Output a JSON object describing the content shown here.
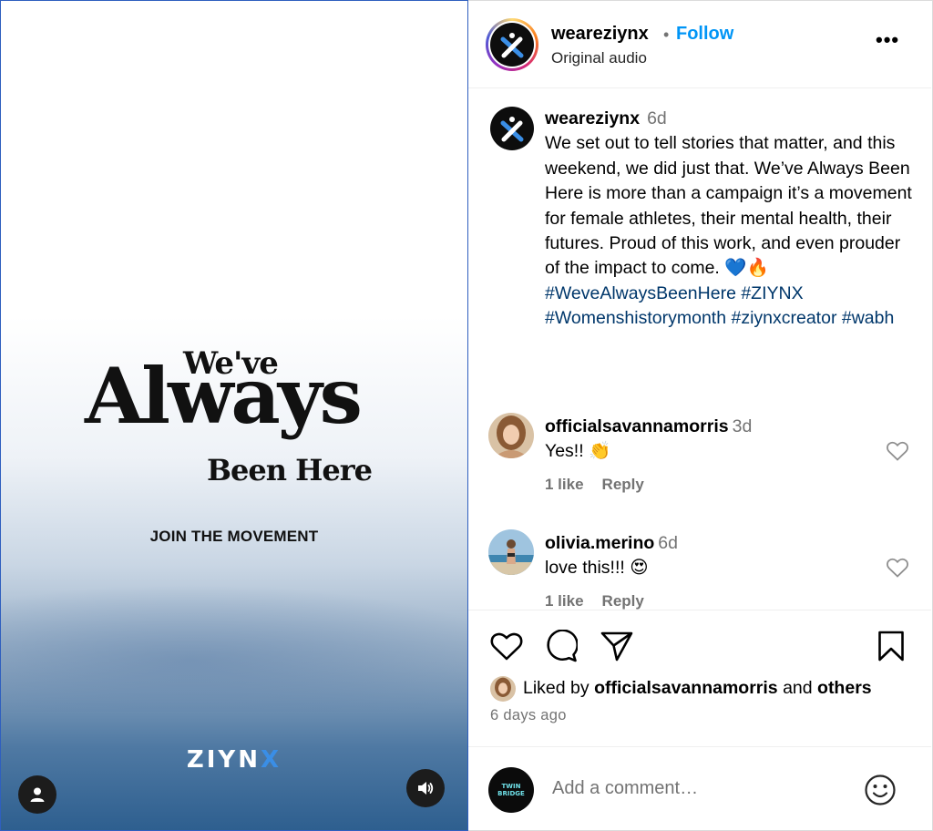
{
  "media": {
    "title_small": "We've",
    "title_big": "Always",
    "title_end": "Been Here",
    "cta": "JOIN THE MOVEMENT",
    "brand_main": "ZIYN",
    "brand_x": "X"
  },
  "header": {
    "username": "weareziynx",
    "separator": "•",
    "follow_label": "Follow",
    "audio": "Original audio",
    "more": "•••"
  },
  "caption": {
    "username": "weareziynx",
    "time": "6d",
    "text": "We set out to tell stories that matter, and this weekend, we did just that. We’ve Always Been Here is more than a campaign it’s a movement for female athletes, their mental health, their futures. Proud of this work, and even prouder of the impact to come. 💙🔥",
    "hashtags": "#WeveAlwaysBeenHere #ZIYNX #Womenshistorymonth #ziynxcreator #wabh"
  },
  "comments": [
    {
      "username": "officialsavannamorris",
      "time": "3d",
      "text": "Yes!! 👏",
      "likes": "1 like",
      "reply": "Reply"
    },
    {
      "username": "olivia.merino",
      "time": "6d",
      "text": "love this!!! 😍",
      "likes": "1 like",
      "reply": "Reply"
    }
  ],
  "likes": {
    "prefix": "Liked by ",
    "user": "officialsavannamorris",
    "middle": " and ",
    "others": "others"
  },
  "posted_ago": "6 days ago",
  "add_comment": {
    "placeholder": "Add a comment…",
    "avatar_text_1": "TWIN",
    "avatar_text_2": "BRIDGE"
  },
  "colors": {
    "follow_blue": "#0095f6",
    "hashtag_navy": "#00376b",
    "muted_gray": "#737373"
  }
}
